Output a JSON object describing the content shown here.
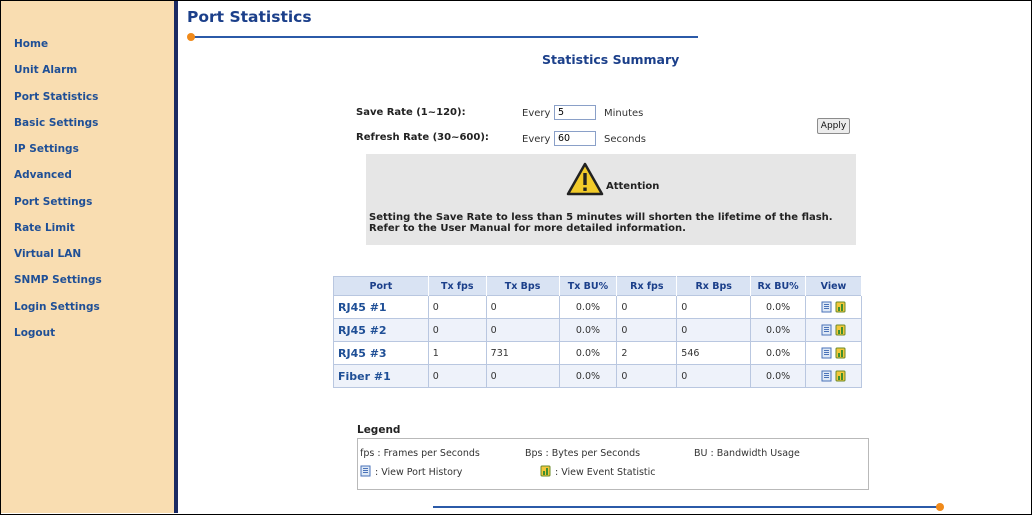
{
  "colors": {
    "sidebar_bg": "#f9ddb1",
    "nav_text": "#1f4f96",
    "title_text": "#1b3f8a",
    "accent_orange": "#f08a1a",
    "rule_blue": "#2b5aa8"
  },
  "sidebar": {
    "items": [
      {
        "label": "Home"
      },
      {
        "label": "Unit Alarm"
      },
      {
        "label": "Port Statistics"
      },
      {
        "label": "Basic Settings"
      },
      {
        "label": "IP Settings"
      },
      {
        "label": "Advanced"
      },
      {
        "label": "Port Settings"
      },
      {
        "label": "Rate Limit"
      },
      {
        "label": "Virtual LAN"
      },
      {
        "label": "SNMP Settings"
      },
      {
        "label": "Login Settings"
      },
      {
        "label": "Logout"
      }
    ]
  },
  "page": {
    "title": "Port Statistics",
    "subtitle": "Statistics Summary"
  },
  "settings": {
    "save_rate": {
      "label": "Save Rate (1~120):",
      "prefix": "Every",
      "value": "5",
      "unit": "Minutes"
    },
    "refresh_rate": {
      "label": "Refresh Rate (30~600):",
      "prefix": "Every",
      "value": "60",
      "unit": "Seconds"
    },
    "apply_label": "Apply"
  },
  "attention": {
    "icon": "warning-triangle-icon",
    "title": "Attention",
    "line1": "Setting the Save Rate to less than 5 minutes will shorten the lifetime of the flash.",
    "line2": "Refer to the User Manual for more detailed information."
  },
  "table": {
    "headers": [
      "Port",
      "Tx fps",
      "Tx Bps",
      "Tx BU%",
      "Rx fps",
      "Rx Bps",
      "Rx BU%",
      "View"
    ],
    "rows": [
      {
        "port": "RJ45 #1",
        "tx_fps": "0",
        "tx_bps": "0",
        "tx_bu": "0.0%",
        "rx_fps": "0",
        "rx_bps": "0",
        "rx_bu": "0.0%"
      },
      {
        "port": "RJ45 #2",
        "tx_fps": "0",
        "tx_bps": "0",
        "tx_bu": "0.0%",
        "rx_fps": "0",
        "rx_bps": "0",
        "rx_bu": "0.0%"
      },
      {
        "port": "RJ45 #3",
        "tx_fps": "1",
        "tx_bps": "731",
        "tx_bu": "0.0%",
        "rx_fps": "2",
        "rx_bps": "546",
        "rx_bu": "0.0%"
      },
      {
        "port": "Fiber #1",
        "tx_fps": "0",
        "tx_bps": "0",
        "tx_bu": "0.0%",
        "rx_fps": "0",
        "rx_bps": "0",
        "rx_bu": "0.0%"
      }
    ]
  },
  "legend": {
    "title": "Legend",
    "fps": "fps : Frames per Seconds",
    "bps": "Bps : Bytes per Seconds",
    "bu": "BU : Bandwidth Usage",
    "port_history": ": View Port History",
    "event_statistic": ": View Event Statistic"
  }
}
